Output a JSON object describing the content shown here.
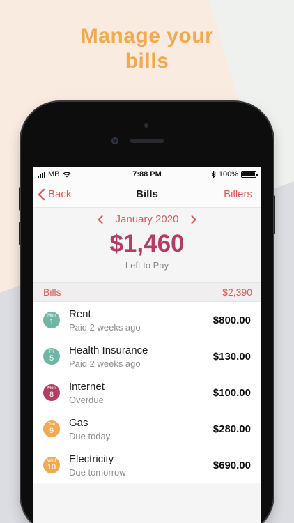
{
  "headline": {
    "line1": "Manage your",
    "line2": "bills"
  },
  "colors": {
    "accent": "#e0595a",
    "amount": "#b43d63",
    "headline": "#f3a94f"
  },
  "status_bar": {
    "carrier": "MB",
    "time": "7:88 PM",
    "battery": "100%"
  },
  "nav": {
    "back_label": "Back",
    "title": "Bills",
    "right_label": "Billers"
  },
  "summary": {
    "month": "January 2020",
    "amount": "$1,460",
    "caption": "Left to Pay"
  },
  "section": {
    "label": "Bills",
    "total": "$2,390"
  },
  "bills": [
    {
      "dow": "Mon",
      "day": "1",
      "name": "Rent",
      "status": "Paid 2 weeks ago",
      "amount": "$800.00",
      "color": "#6fb6a7"
    },
    {
      "dow": "Fri",
      "day": "5",
      "name": "Health Insurance",
      "status": "Paid 2 weeks ago",
      "amount": "$130.00",
      "color": "#6fb6a7"
    },
    {
      "dow": "Mon",
      "day": "8",
      "name": "Internet",
      "status": "Overdue",
      "amount": "$100.00",
      "color": "#b43d63"
    },
    {
      "dow": "Tue",
      "day": "9",
      "name": "Gas",
      "status": "Due today",
      "amount": "$280.00",
      "color": "#f3a94f"
    },
    {
      "dow": "Wed",
      "day": "10",
      "name": "Electricity",
      "status": "Due tomorrow",
      "amount": "$690.00",
      "color": "#f3a94f"
    }
  ]
}
